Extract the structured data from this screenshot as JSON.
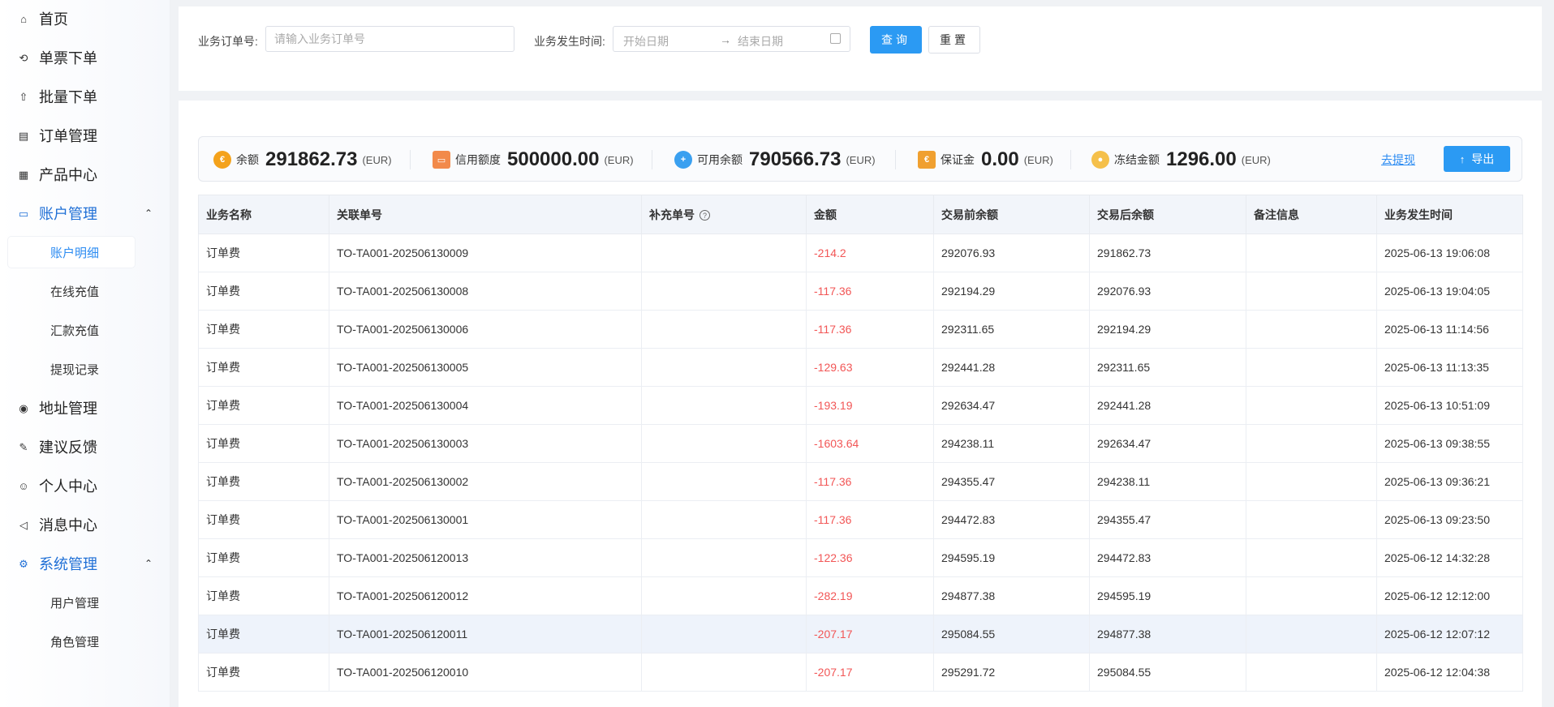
{
  "sidebar": {
    "items": [
      {
        "label": "首页",
        "icon": "home-icon",
        "glyph": "⌂"
      },
      {
        "label": "单票下单",
        "icon": "refresh-icon",
        "glyph": "⟲"
      },
      {
        "label": "批量下单",
        "icon": "rocket-icon",
        "glyph": "⇧"
      },
      {
        "label": "订单管理",
        "icon": "document-icon",
        "glyph": "▤"
      },
      {
        "label": "产品中心",
        "icon": "grid-icon",
        "glyph": "▦"
      },
      {
        "label": "账户管理",
        "icon": "card-icon",
        "glyph": "▭"
      },
      {
        "label": "地址管理",
        "icon": "location-icon",
        "glyph": "◉"
      },
      {
        "label": "建议反馈",
        "icon": "edit-icon",
        "glyph": "✎"
      },
      {
        "label": "个人中心",
        "icon": "user-icon",
        "glyph": "☺"
      },
      {
        "label": "消息中心",
        "icon": "speaker-icon",
        "glyph": "◁"
      },
      {
        "label": "系统管理",
        "icon": "gear-icon",
        "glyph": "⚙"
      }
    ],
    "account_sub": [
      "账户明细",
      "在线充值",
      "汇款充值",
      "提现记录"
    ],
    "system_sub": [
      "用户管理",
      "角色管理"
    ],
    "chevron": "⌃"
  },
  "search": {
    "order_label": "业务订单号:",
    "order_placeholder": "请输入业务订单号",
    "time_label": "业务发生时间:",
    "start_placeholder": "开始日期",
    "arrow": "→",
    "end_placeholder": "结束日期",
    "query_label": "查询",
    "reset_label": "重置"
  },
  "summary": {
    "balance_label": "余额",
    "balance_value": "291862.73",
    "credit_label": "信用额度",
    "credit_value": "500000.00",
    "available_label": "可用余额",
    "available_value": "790566.73",
    "deposit_label": "保证金",
    "deposit_value": "0.00",
    "frozen_label": "冻结金额",
    "frozen_value": "1296.00",
    "unit": "(EUR)",
    "withdraw_label": "去提现",
    "export_label": "导出",
    "colors": {
      "balance": "#f4a21b",
      "credit": "#f28a4a",
      "available": "#3aa0f0",
      "deposit": "#f0a030",
      "frozen": "#f5c04a"
    }
  },
  "table": {
    "headers": [
      "业务名称",
      "关联单号",
      "补充单号",
      "金额",
      "交易前余额",
      "交易后余额",
      "备注信息",
      "业务发生时间"
    ],
    "rows": [
      [
        "订单费",
        "TO-TA001-202506130009",
        "",
        "-214.2",
        "292076.93",
        "291862.73",
        "",
        "2025-06-13 19:06:08"
      ],
      [
        "订单费",
        "TO-TA001-202506130008",
        "",
        "-117.36",
        "292194.29",
        "292076.93",
        "",
        "2025-06-13 19:04:05"
      ],
      [
        "订单费",
        "TO-TA001-202506130006",
        "",
        "-117.36",
        "292311.65",
        "292194.29",
        "",
        "2025-06-13 11:14:56"
      ],
      [
        "订单费",
        "TO-TA001-202506130005",
        "",
        "-129.63",
        "292441.28",
        "292311.65",
        "",
        "2025-06-13 11:13:35"
      ],
      [
        "订单费",
        "TO-TA001-202506130004",
        "",
        "-193.19",
        "292634.47",
        "292441.28",
        "",
        "2025-06-13 10:51:09"
      ],
      [
        "订单费",
        "TO-TA001-202506130003",
        "",
        "-1603.64",
        "294238.11",
        "292634.47",
        "",
        "2025-06-13 09:38:55"
      ],
      [
        "订单费",
        "TO-TA001-202506130002",
        "",
        "-117.36",
        "294355.47",
        "294238.11",
        "",
        "2025-06-13 09:36:21"
      ],
      [
        "订单费",
        "TO-TA001-202506130001",
        "",
        "-117.36",
        "294472.83",
        "294355.47",
        "",
        "2025-06-13 09:23:50"
      ],
      [
        "订单费",
        "TO-TA001-202506120013",
        "",
        "-122.36",
        "294595.19",
        "294472.83",
        "",
        "2025-06-12 14:32:28"
      ],
      [
        "订单费",
        "TO-TA001-202506120012",
        "",
        "-282.19",
        "294877.38",
        "294595.19",
        "",
        "2025-06-12 12:12:00"
      ],
      [
        "订单费",
        "TO-TA001-202506120011",
        "",
        "-207.17",
        "295084.55",
        "294877.38",
        "",
        "2025-06-12 12:07:12"
      ],
      [
        "订单费",
        "TO-TA001-202506120010",
        "",
        "-207.17",
        "295291.72",
        "295084.55",
        "",
        "2025-06-12 12:04:38"
      ]
    ],
    "highlighted_row": 10,
    "negative_color": "#f25656"
  }
}
